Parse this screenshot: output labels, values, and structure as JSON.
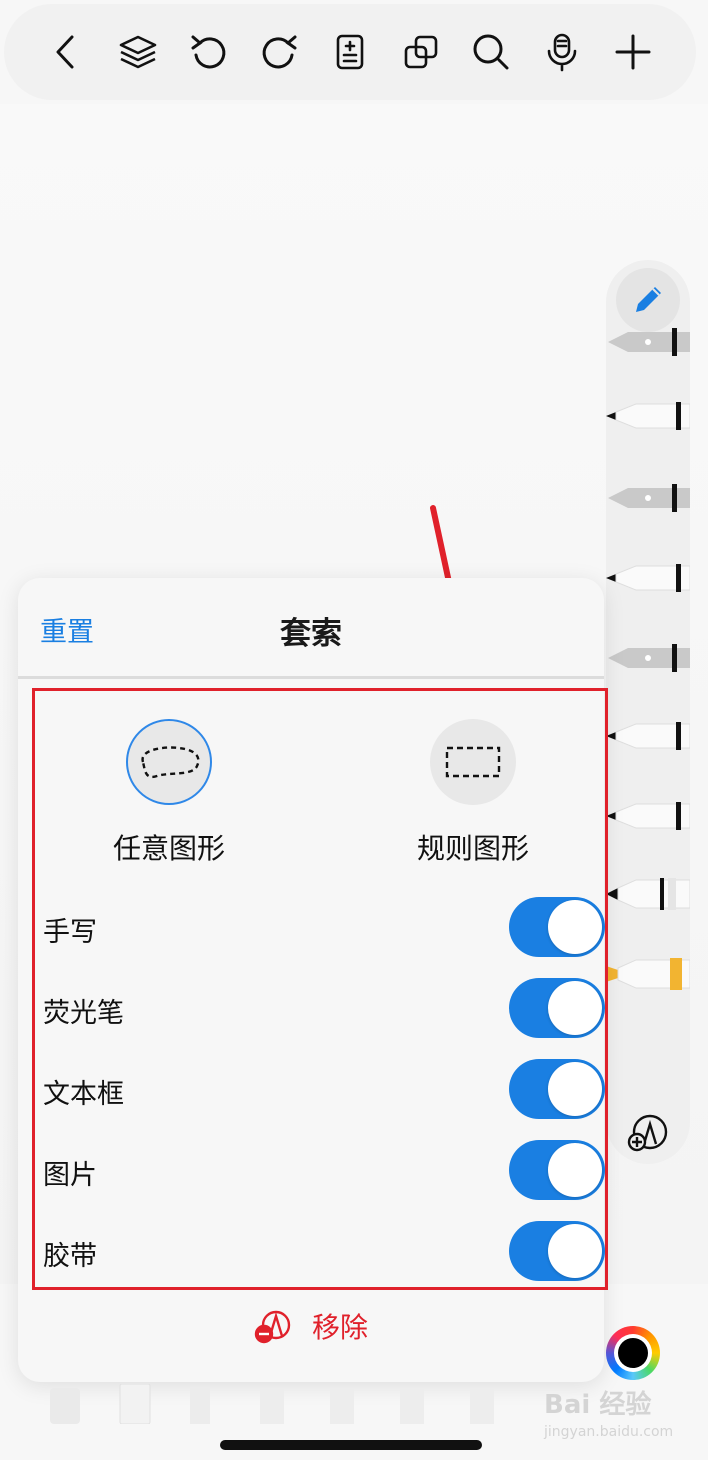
{
  "toolbar": {
    "icons": [
      "back-icon",
      "layers-icon",
      "undo-icon",
      "redo-icon",
      "page-add-icon",
      "duplicate-icon",
      "search-icon",
      "microphone-icon",
      "plus-icon"
    ]
  },
  "lasso_panel": {
    "reset_label": "重置",
    "title": "套索",
    "shapes": [
      {
        "label": "任意图形",
        "icon": "freeform-lasso-icon",
        "selected": true
      },
      {
        "label": "规则图形",
        "icon": "rectangle-lasso-icon",
        "selected": false
      }
    ],
    "toggles": [
      {
        "label": "手写",
        "on": true
      },
      {
        "label": "荧光笔",
        "on": true
      },
      {
        "label": "文本框",
        "on": true
      },
      {
        "label": "图片",
        "on": true
      },
      {
        "label": "胶带",
        "on": true
      }
    ],
    "remove_label": "移除"
  },
  "colors": {
    "accent": "#1a7fe2",
    "annotation_red": "#e0212b",
    "highlighter_yellow": "#f2b431"
  },
  "watermark": {
    "text": "Bai 经验",
    "url": "jingyan.baidu.com"
  }
}
